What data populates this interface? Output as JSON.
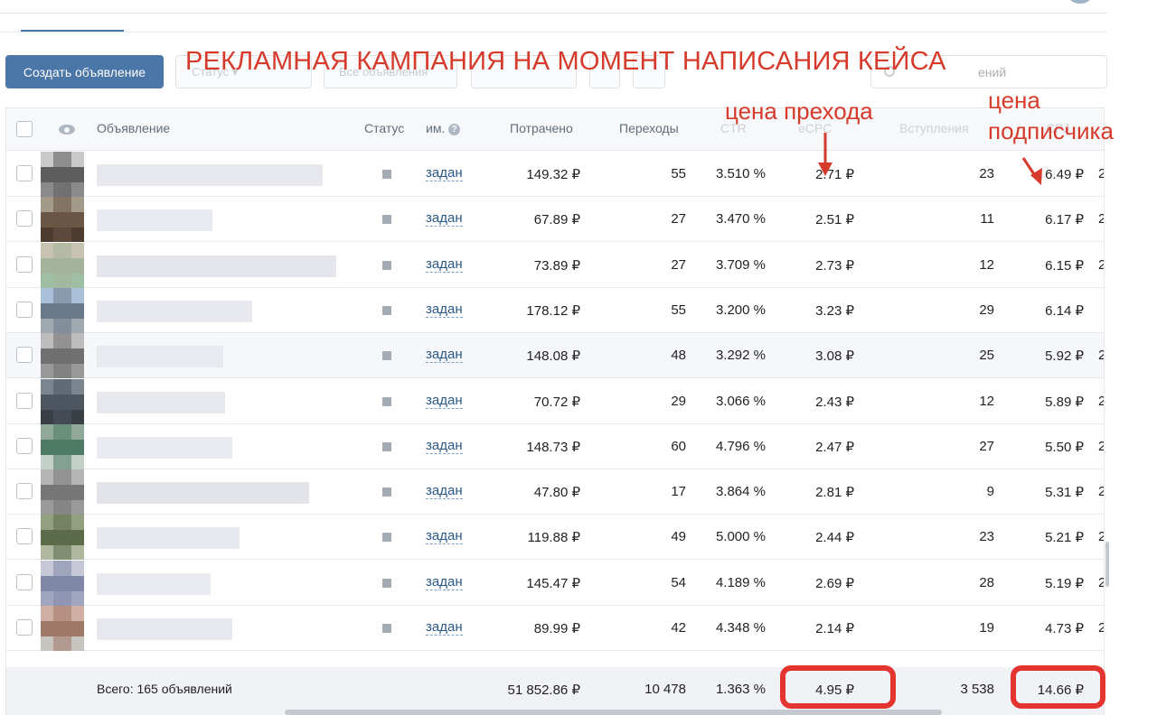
{
  "toolbar": {
    "create_label": "Создать объявление",
    "ghost1": "Статус ▾",
    "ghost2": "Все объявления",
    "search_placeholder": "ений"
  },
  "annotations": {
    "banner": "РЕКЛАМНАЯ КАМПАНИЯ НА МОМЕНТ НАПИСАНИЯ КЕЙСА",
    "cpc_note": "цена прехода",
    "sub_note_line1": "цена",
    "sub_note_line2": "подписчика",
    "accent_color": "#d63a2b"
  },
  "table": {
    "columns": {
      "ad": "Объявление",
      "status": "Статус",
      "im": "им.",
      "spent": "Потрачено",
      "clicks": "Переходы",
      "ctr": "CTR",
      "ecpc": "eCPC",
      "joins": "Вступления",
      "cpj": "CPJ"
    },
    "rows": [
      {
        "status": "задан",
        "spent": "149.32 ₽",
        "clicks": "55",
        "ctr": "3.510 %",
        "ecpc": "2.71 ₽",
        "joins": "23",
        "cpj": "6.49 ₽",
        "cut": "2"
      },
      {
        "status": "задан",
        "spent": "67.89 ₽",
        "clicks": "27",
        "ctr": "3.470 %",
        "ecpc": "2.51 ₽",
        "joins": "11",
        "cpj": "6.17 ₽",
        "cut": "2"
      },
      {
        "status": "задан",
        "spent": "73.89 ₽",
        "clicks": "27",
        "ctr": "3.709 %",
        "ecpc": "2.73 ₽",
        "joins": "12",
        "cpj": "6.15 ₽",
        "cut": "2"
      },
      {
        "status": "задан",
        "spent": "178.12 ₽",
        "clicks": "55",
        "ctr": "3.200 %",
        "ecpc": "3.23 ₽",
        "joins": "29",
        "cpj": "6.14 ₽",
        "cut": ""
      },
      {
        "status": "задан",
        "spent": "148.08 ₽",
        "clicks": "48",
        "ctr": "3.292 %",
        "ecpc": "3.08 ₽",
        "joins": "25",
        "cpj": "5.92 ₽",
        "cut": "2"
      },
      {
        "status": "задан",
        "spent": "70.72 ₽",
        "clicks": "29",
        "ctr": "3.066 %",
        "ecpc": "2.43 ₽",
        "joins": "12",
        "cpj": "5.89 ₽",
        "cut": "2"
      },
      {
        "status": "задан",
        "spent": "148.73 ₽",
        "clicks": "60",
        "ctr": "4.796 %",
        "ecpc": "2.47 ₽",
        "joins": "27",
        "cpj": "5.50 ₽",
        "cut": "2"
      },
      {
        "status": "задан",
        "spent": "47.80 ₽",
        "clicks": "17",
        "ctr": "3.864 %",
        "ecpc": "2.81 ₽",
        "joins": "9",
        "cpj": "5.31 ₽",
        "cut": "2"
      },
      {
        "status": "задан",
        "spent": "119.88 ₽",
        "clicks": "49",
        "ctr": "5.000 %",
        "ecpc": "2.44 ₽",
        "joins": "23",
        "cpj": "5.21 ₽",
        "cut": "2"
      },
      {
        "status": "задан",
        "spent": "145.47 ₽",
        "clicks": "54",
        "ctr": "4.189 %",
        "ecpc": "2.69 ₽",
        "joins": "28",
        "cpj": "5.19 ₽",
        "cut": "2"
      },
      {
        "status": "задан",
        "spent": "89.99 ₽",
        "clicks": "42",
        "ctr": "4.348 %",
        "ecpc": "2.14 ₽",
        "joins": "19",
        "cpj": "4.73 ₽",
        "cut": "2"
      }
    ],
    "total": {
      "label": "Всего: 165 объявлений",
      "spent": "51 852.86 ₽",
      "clicks": "10 478",
      "ctr": "1.363 %",
      "ecpc": "4.95 ₽",
      "joins": "3 538",
      "cpj": "14.66 ₽"
    }
  }
}
